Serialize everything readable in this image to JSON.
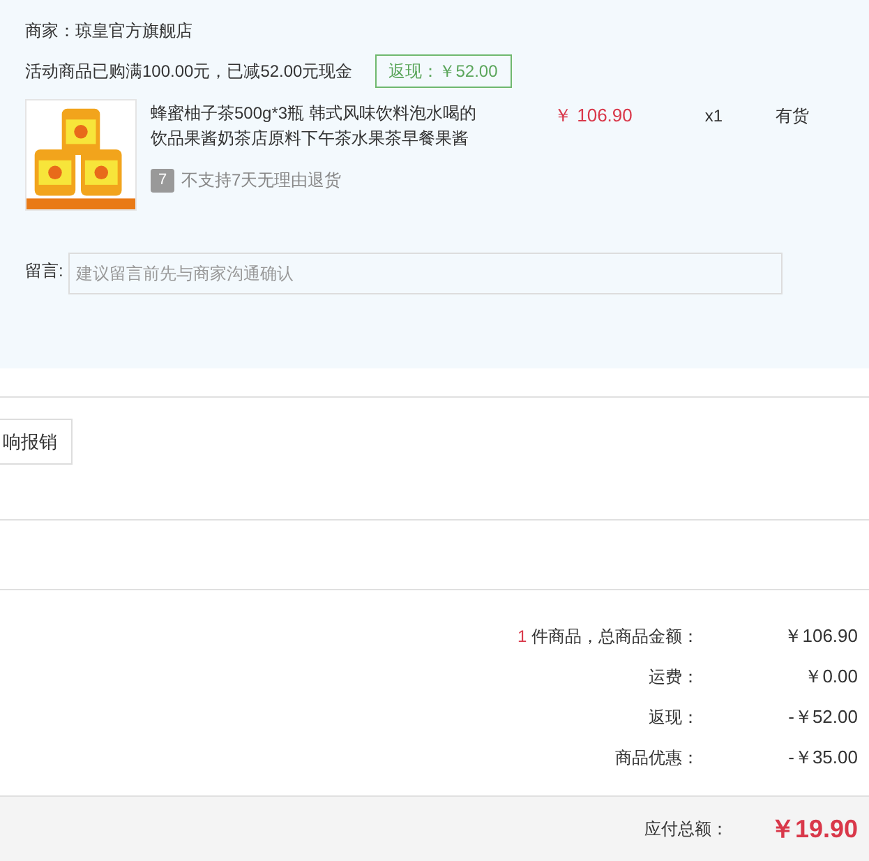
{
  "shop": {
    "label": "商家：",
    "name": "琼皇官方旗舰店"
  },
  "promo": {
    "text": "活动商品已购满100.00元，已减52.00元现金",
    "badge": "返现：￥52.00"
  },
  "item": {
    "title": "蜂蜜柚子茶500g*3瓶 韩式风味饮料泡水喝的饮品果酱奶茶店原料下午茶水果茶早餐果酱",
    "price": "￥ 106.90",
    "quantity": "x1",
    "stock": "有货",
    "return_badge": "7",
    "return_policy": "不支持7天无理由退货"
  },
  "message": {
    "label": "留言:",
    "placeholder": "建议留言前先与商家沟通确认"
  },
  "invoice_button": "响报销",
  "summary": [
    {
      "count": "1",
      "label": " 件商品，总商品金额：",
      "value": "￥106.90"
    },
    {
      "label": "运费：",
      "value": "￥0.00"
    },
    {
      "label": "返现：",
      "value": "-￥52.00"
    },
    {
      "label": "商品优惠：",
      "value": "-￥35.00"
    }
  ],
  "total": {
    "label": "应付总额：",
    "value": "￥19.90"
  }
}
